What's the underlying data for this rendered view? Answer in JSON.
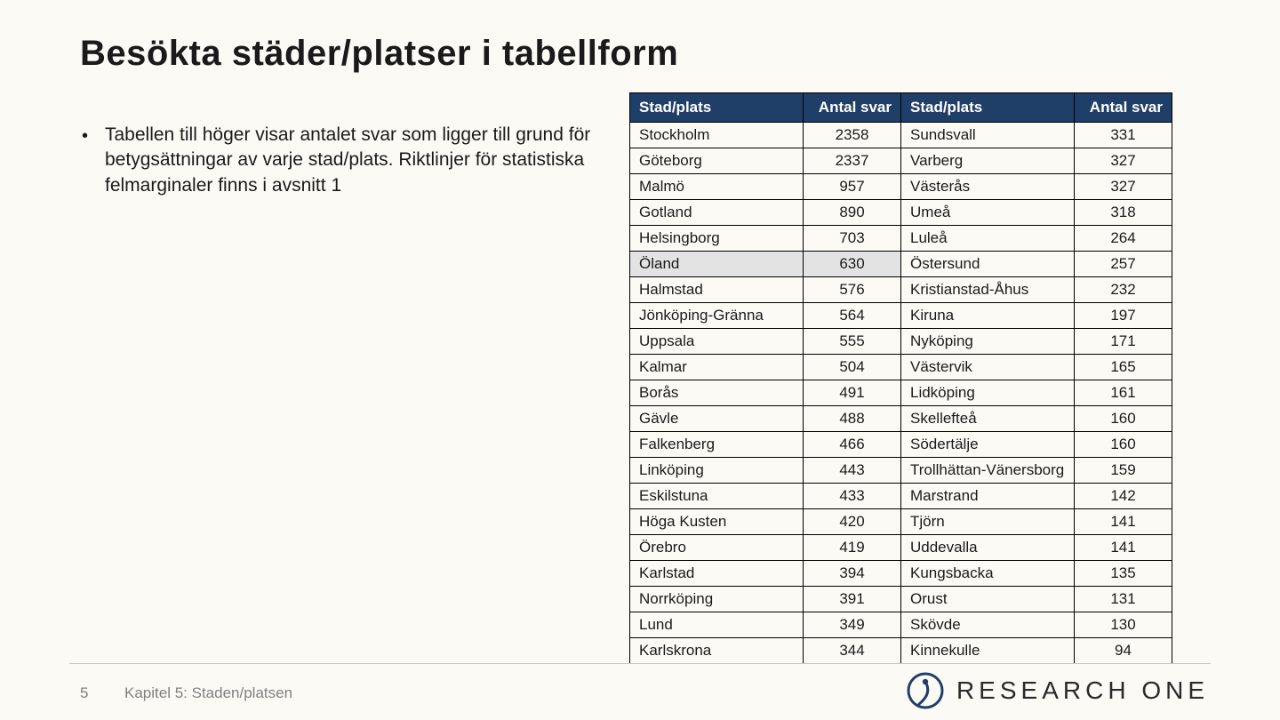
{
  "title": "Besökta städer/platser i tabellform",
  "bullet": "Tabellen till höger visar antalet svar som ligger till grund för betygsättningar av varje stad/plats. Riktlinjer för statistiska felmarginaler finns i avsnitt 1",
  "table": {
    "headers": {
      "name": "Stad/plats",
      "value": "Antal svar"
    },
    "left": [
      {
        "name": "Stockholm",
        "value": 2358
      },
      {
        "name": "Göteborg",
        "value": 2337
      },
      {
        "name": "Malmö",
        "value": 957
      },
      {
        "name": "Gotland",
        "value": 890
      },
      {
        "name": "Helsingborg",
        "value": 703
      },
      {
        "name": "Öland",
        "value": 630,
        "highlight": true
      },
      {
        "name": "Halmstad",
        "value": 576
      },
      {
        "name": "Jönköping-Gränna",
        "value": 564
      },
      {
        "name": "Uppsala",
        "value": 555
      },
      {
        "name": "Kalmar",
        "value": 504
      },
      {
        "name": "Borås",
        "value": 491
      },
      {
        "name": "Gävle",
        "value": 488
      },
      {
        "name": "Falkenberg",
        "value": 466
      },
      {
        "name": "Linköping",
        "value": 443
      },
      {
        "name": "Eskilstuna",
        "value": 433
      },
      {
        "name": "Höga Kusten",
        "value": 420
      },
      {
        "name": "Örebro",
        "value": 419
      },
      {
        "name": "Karlstad",
        "value": 394
      },
      {
        "name": "Norrköping",
        "value": 391
      },
      {
        "name": "Lund",
        "value": 349
      },
      {
        "name": "Karlskrona",
        "value": 344
      }
    ],
    "right": [
      {
        "name": "Sundsvall",
        "value": 331
      },
      {
        "name": "Varberg",
        "value": 327
      },
      {
        "name": "Västerås",
        "value": 327
      },
      {
        "name": "Umeå",
        "value": 318
      },
      {
        "name": "Luleå",
        "value": 264
      },
      {
        "name": "Östersund",
        "value": 257
      },
      {
        "name": "Kristianstad-Åhus",
        "value": 232
      },
      {
        "name": "Kiruna",
        "value": 197
      },
      {
        "name": "Nyköping",
        "value": 171
      },
      {
        "name": "Västervik",
        "value": 165
      },
      {
        "name": "Lidköping",
        "value": 161
      },
      {
        "name": "Skellefteå",
        "value": 160
      },
      {
        "name": "Södertälje",
        "value": 160
      },
      {
        "name": "Trollhättan-Vänersborg",
        "value": 159
      },
      {
        "name": "Marstrand",
        "value": 142
      },
      {
        "name": "Tjörn",
        "value": 141
      },
      {
        "name": "Uddevalla",
        "value": 141
      },
      {
        "name": "Kungsbacka",
        "value": 135
      },
      {
        "name": "Orust",
        "value": 131
      },
      {
        "name": "Skövde",
        "value": 130
      },
      {
        "name": "Kinnekulle",
        "value": 94
      }
    ]
  },
  "footer": {
    "page": "5",
    "chapter": "Kapitel 5: Staden/platsen",
    "logo_text": "RESEARCH ONE"
  },
  "chart_data": {
    "type": "table",
    "title": "Besökta städer/platser i tabellform",
    "columns": [
      "Stad/plats",
      "Antal svar"
    ],
    "rows": [
      [
        "Stockholm",
        2358
      ],
      [
        "Göteborg",
        2337
      ],
      [
        "Malmö",
        957
      ],
      [
        "Gotland",
        890
      ],
      [
        "Helsingborg",
        703
      ],
      [
        "Öland",
        630
      ],
      [
        "Halmstad",
        576
      ],
      [
        "Jönköping-Gränna",
        564
      ],
      [
        "Uppsala",
        555
      ],
      [
        "Kalmar",
        504
      ],
      [
        "Borås",
        491
      ],
      [
        "Gävle",
        488
      ],
      [
        "Falkenberg",
        466
      ],
      [
        "Linköping",
        443
      ],
      [
        "Eskilstuna",
        433
      ],
      [
        "Höga Kusten",
        420
      ],
      [
        "Örebro",
        419
      ],
      [
        "Karlstad",
        394
      ],
      [
        "Norrköping",
        391
      ],
      [
        "Lund",
        349
      ],
      [
        "Karlskrona",
        344
      ],
      [
        "Sundsvall",
        331
      ],
      [
        "Varberg",
        327
      ],
      [
        "Västerås",
        327
      ],
      [
        "Umeå",
        318
      ],
      [
        "Luleå",
        264
      ],
      [
        "Östersund",
        257
      ],
      [
        "Kristianstad-Åhus",
        232
      ],
      [
        "Kiruna",
        197
      ],
      [
        "Nyköping",
        171
      ],
      [
        "Västervik",
        165
      ],
      [
        "Lidköping",
        161
      ],
      [
        "Skellefteå",
        160
      ],
      [
        "Södertälje",
        160
      ],
      [
        "Trollhättan-Vänersborg",
        159
      ],
      [
        "Marstrand",
        142
      ],
      [
        "Tjörn",
        141
      ],
      [
        "Uddevalla",
        141
      ],
      [
        "Kungsbacka",
        135
      ],
      [
        "Orust",
        131
      ],
      [
        "Skövde",
        130
      ],
      [
        "Kinnekulle",
        94
      ]
    ]
  }
}
